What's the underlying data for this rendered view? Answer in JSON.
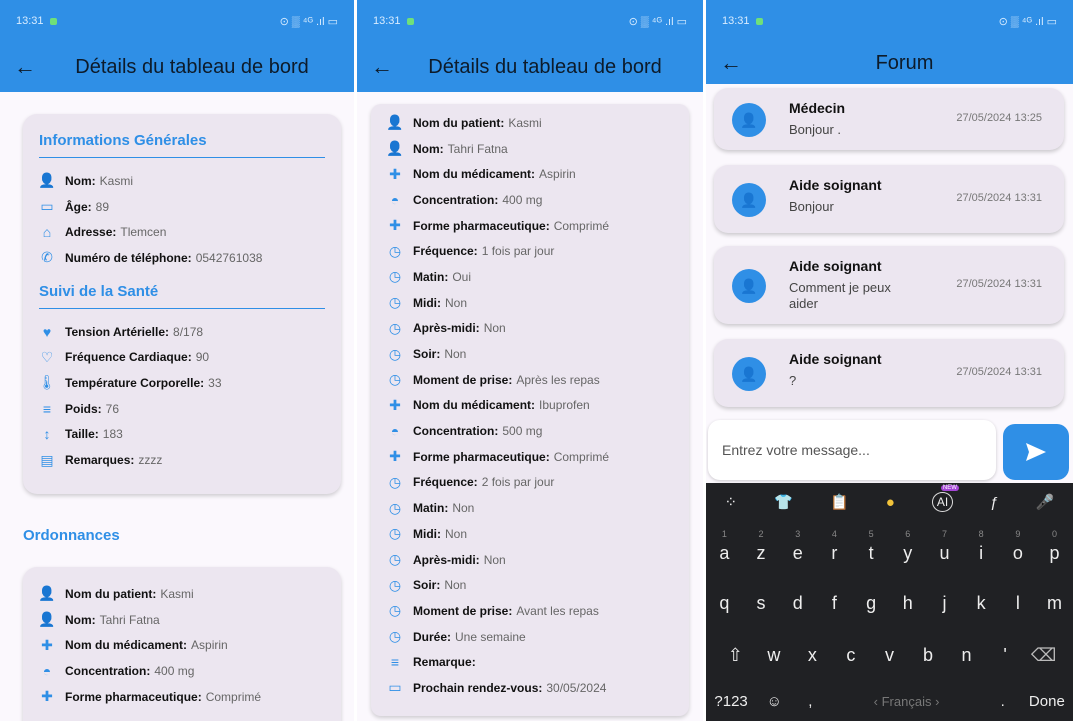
{
  "status": {
    "time": "13:31",
    "icons": "⊙ ▒ ⁴ᴳ .ıl ▭"
  },
  "screen1": {
    "title": "Détails du tableau de bord",
    "general_title": "Informations Générales",
    "general": [
      {
        "icon": "person-icon",
        "glyph": "👤",
        "label": "Nom:",
        "value": "Kasmi"
      },
      {
        "icon": "calendar-icon",
        "glyph": "▭",
        "label": "Âge:",
        "value": "89"
      },
      {
        "icon": "home-icon",
        "glyph": "⌂",
        "label": "Adresse:",
        "value": "Tlemcen"
      },
      {
        "icon": "phone-icon",
        "glyph": "✆",
        "label": "Numéro de téléphone:",
        "value": "0542761038"
      }
    ],
    "health_title": "Suivi de la Santé",
    "health": [
      {
        "icon": "heart-icon",
        "glyph": "♥",
        "label": "Tension Artérielle:",
        "value": "8/178"
      },
      {
        "icon": "heart-outline-icon",
        "glyph": "♡",
        "label": "Fréquence Cardiaque:",
        "value": "90"
      },
      {
        "icon": "thermometer-icon",
        "glyph": "🌡",
        "label": "Température Corporelle:",
        "value": "33"
      },
      {
        "icon": "weight-icon",
        "glyph": "≡",
        "label": "Poids:",
        "value": "76"
      },
      {
        "icon": "height-icon",
        "glyph": "↕",
        "label": "Taille:",
        "value": "183"
      },
      {
        "icon": "comment-icon",
        "glyph": "▤",
        "label": "Remarques:",
        "value": "zzzz"
      }
    ],
    "ordo_title": "Ordonnances",
    "ordo": [
      {
        "icon": "person-icon",
        "glyph": "👤",
        "label": "Nom du patient:",
        "value": "Kasmi"
      },
      {
        "icon": "person-icon",
        "glyph": "👤",
        "label": "Nom:",
        "value": "Tahri Fatna"
      },
      {
        "icon": "medical-bag-icon",
        "glyph": "✚",
        "label": "Nom du médicament:",
        "value": "Aspirin"
      },
      {
        "icon": "drop-icon",
        "glyph": "◓",
        "label": "Concentration:",
        "value": "400 mg"
      },
      {
        "icon": "medical-bag-icon",
        "glyph": "✚",
        "label": "Forme pharmaceutique:",
        "value": "Comprimé"
      }
    ]
  },
  "screen2": {
    "title": "Détails du tableau de bord",
    "rows": [
      {
        "icon": "person-icon",
        "glyph": "👤",
        "label": "Nom du patient:",
        "value": "Kasmi"
      },
      {
        "icon": "person-icon",
        "glyph": "👤",
        "label": "Nom:",
        "value": "Tahri Fatna"
      },
      {
        "icon": "medical-bag-icon",
        "glyph": "✚",
        "label": "Nom du médicament:",
        "value": "Aspirin"
      },
      {
        "icon": "drop-icon",
        "glyph": "◓",
        "label": "Concentration:",
        "value": "400 mg"
      },
      {
        "icon": "medical-bag-icon",
        "glyph": "✚",
        "label": "Forme pharmaceutique:",
        "value": "Comprimé"
      },
      {
        "icon": "clock-icon",
        "glyph": "◷",
        "label": "Fréquence:",
        "value": "1 fois par jour"
      },
      {
        "icon": "clock-icon",
        "glyph": "◷",
        "label": "Matin:",
        "value": "Oui"
      },
      {
        "icon": "clock-icon",
        "glyph": "◷",
        "label": "Midi:",
        "value": "Non"
      },
      {
        "icon": "clock-icon",
        "glyph": "◷",
        "label": "Après-midi:",
        "value": "Non"
      },
      {
        "icon": "clock-icon",
        "glyph": "◷",
        "label": "Soir:",
        "value": "Non"
      },
      {
        "icon": "clock-icon",
        "glyph": "◷",
        "label": "Moment de prise:",
        "value": "Après les repas"
      },
      {
        "icon": "medical-bag-icon",
        "glyph": "✚",
        "label": "Nom du médicament:",
        "value": "Ibuprofen"
      },
      {
        "icon": "drop-icon",
        "glyph": "◓",
        "label": "Concentration:",
        "value": "500 mg"
      },
      {
        "icon": "medical-bag-icon",
        "glyph": "✚",
        "label": "Forme pharmaceutique:",
        "value": "Comprimé"
      },
      {
        "icon": "clock-icon",
        "glyph": "◷",
        "label": "Fréquence:",
        "value": "2 fois par jour"
      },
      {
        "icon": "clock-icon",
        "glyph": "◷",
        "label": "Matin:",
        "value": "Non"
      },
      {
        "icon": "clock-icon",
        "glyph": "◷",
        "label": "Midi:",
        "value": "Non"
      },
      {
        "icon": "clock-icon",
        "glyph": "◷",
        "label": "Après-midi:",
        "value": "Non"
      },
      {
        "icon": "clock-icon",
        "glyph": "◷",
        "label": "Soir:",
        "value": "Non"
      },
      {
        "icon": "clock-icon",
        "glyph": "◷",
        "label": "Moment de prise:",
        "value": "Avant les repas"
      },
      {
        "icon": "clock-icon",
        "glyph": "◷",
        "label": "Durée:",
        "value": "Une semaine"
      },
      {
        "icon": "notes-icon",
        "glyph": "≡",
        "label": "Remarque:",
        "value": ""
      },
      {
        "icon": "calendar-icon",
        "glyph": "▭",
        "label": "Prochain rendez-vous:",
        "value": "30/05/2024"
      }
    ]
  },
  "screen3": {
    "title": "Forum",
    "messages": [
      {
        "author": "Médecin",
        "text": "Bonjour .",
        "time": "27/05/2024 13:25"
      },
      {
        "author": "Aide soignant",
        "text": "Bonjour",
        "time": "27/05/2024 13:31"
      },
      {
        "author": "Aide soignant",
        "text": "Comment je peux aider",
        "time": "27/05/2024 13:31"
      },
      {
        "author": "Aide soignant",
        "text": "?",
        "time": "27/05/2024 13:31"
      }
    ],
    "input_placeholder": "Entrez votre message...",
    "keyboard": {
      "row1": [
        "a",
        "z",
        "e",
        "r",
        "t",
        "y",
        "u",
        "i",
        "o",
        "p"
      ],
      "row1_nums": [
        "1",
        "2",
        "3",
        "4",
        "5",
        "6",
        "7",
        "8",
        "9",
        "0"
      ],
      "row2": [
        "q",
        "s",
        "d",
        "f",
        "g",
        "h",
        "j",
        "k",
        "l",
        "m"
      ],
      "row3": [
        "w",
        "x",
        "c",
        "v",
        "b",
        "n",
        "'"
      ],
      "sym_label": "?123",
      "comma": ",",
      "space_label": "Français",
      "period": ".",
      "done_label": "Done",
      "ai_badge": "NEW",
      "ai_label": "AI"
    }
  },
  "colors": {
    "accent": "#2f8fe6",
    "card": "#ece6f0"
  }
}
